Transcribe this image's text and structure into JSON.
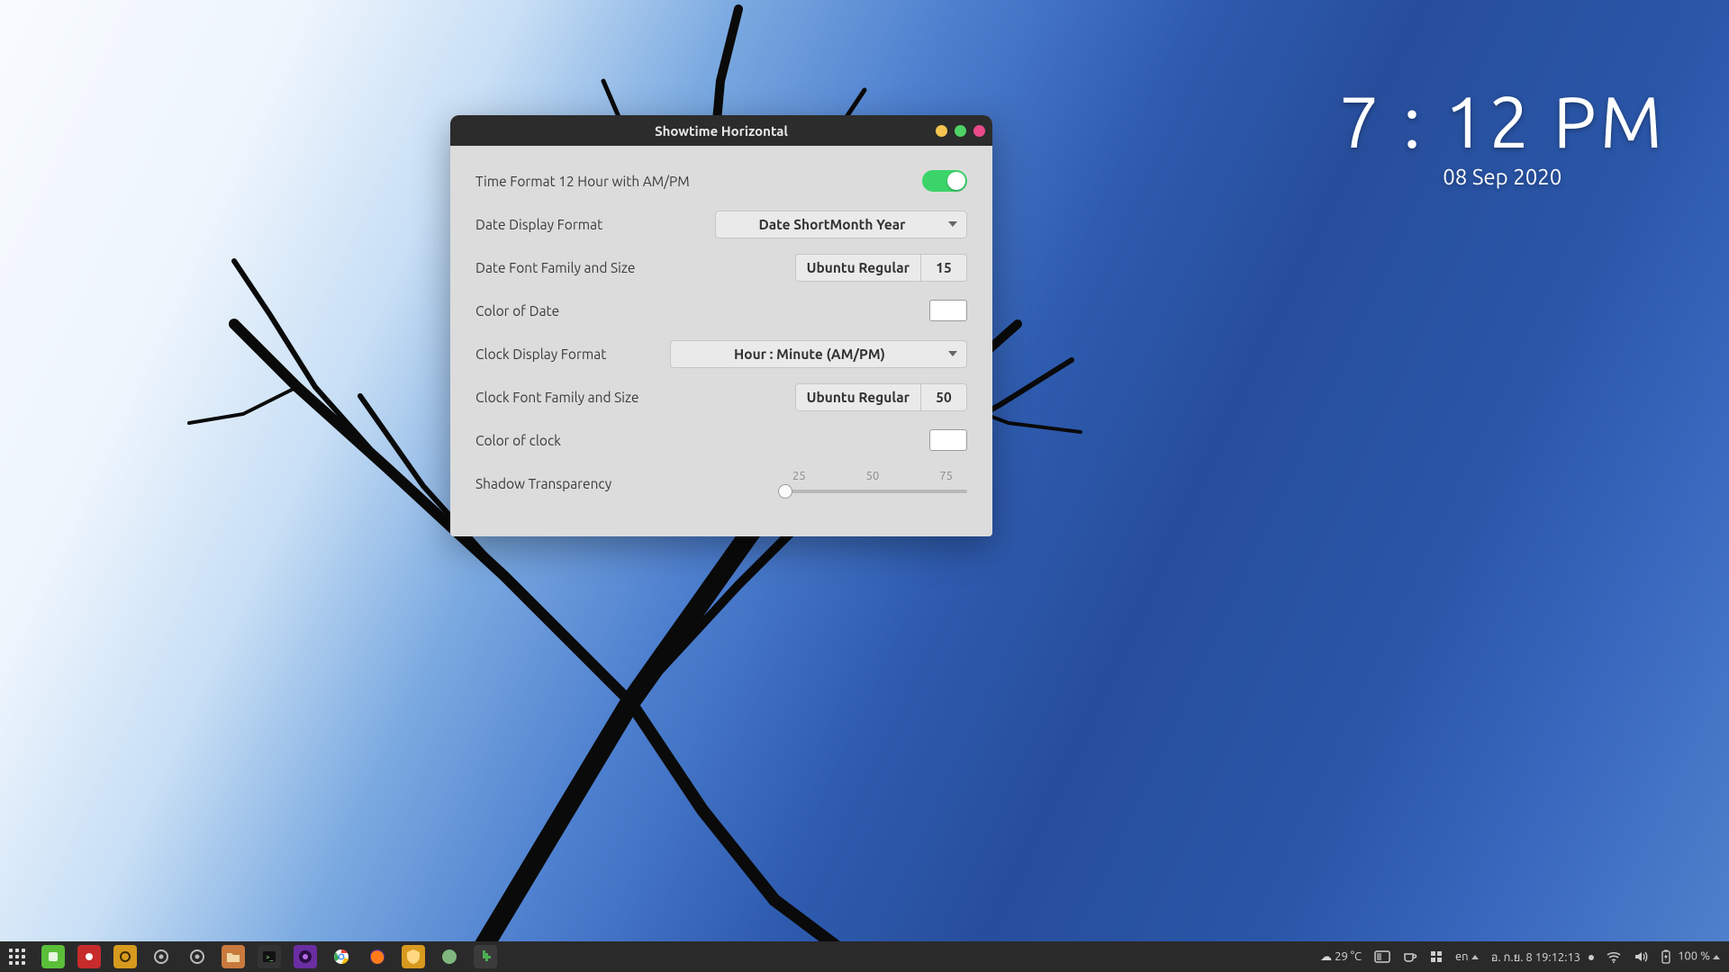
{
  "widget": {
    "time": "7 : 12 PM",
    "date": "08 Sep 2020"
  },
  "window": {
    "title": "Showtime Horizontal",
    "rows": {
      "timeformat_label": "Time Format 12 Hour with AM/PM",
      "dateformat_label": "Date Display Format",
      "dateformat_value": "Date ShortMonth Year",
      "datefont_label": "Date Font Family and Size",
      "datefont_family": "Ubuntu Regular",
      "datefont_size": "15",
      "datecolor_label": "Color of Date",
      "datecolor_value": "#ffffff",
      "clockformat_label": "Clock Display Format",
      "clockformat_value": "Hour : Minute (AM/PM)",
      "clockfont_label": "Clock Font Family and Size",
      "clockfont_family": "Ubuntu Regular",
      "clockfont_size": "50",
      "clockcolor_label": "Color of clock",
      "clockcolor_value": "#ffffff",
      "shadow_label": "Shadow Transparency",
      "shadow_ticks": {
        "t25": "25",
        "t50": "50",
        "t75": "75"
      },
      "shadow_value": 0
    }
  },
  "taskbar": {
    "weather": "29 °C",
    "lang": "en",
    "datetime": "อ. ก.ย. 8  19:12:13",
    "battery": "100 %"
  }
}
